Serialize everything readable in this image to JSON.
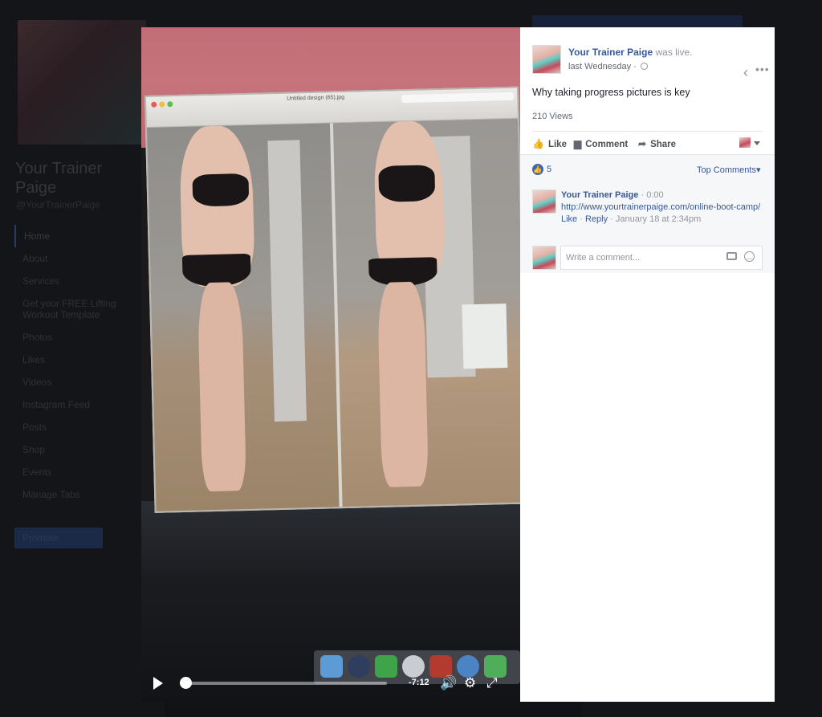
{
  "background_page": {
    "title": "Your Trainer Paige",
    "handle": "@YourTrainerPaige",
    "nav": [
      "Home",
      "About",
      "Services",
      "Get your FREE Lifting Workout Template",
      "Photos",
      "Likes",
      "Videos",
      "Instagram Feed",
      "Posts",
      "Shop",
      "Events",
      "Manage Tabs"
    ],
    "promote_label": "Promote"
  },
  "video": {
    "screen_title": "Untitled design (65).jpg",
    "time_remaining": "-7:12",
    "progress": 0.02,
    "play_label": "▶",
    "volume_icon": "🔊",
    "settings_icon": "⚙",
    "fullscreen_icon": "⤢"
  },
  "post": {
    "author": "Your Trainer Paige",
    "status": "was live.",
    "timestamp": "last Wednesday",
    "text": "Why taking progress pictures is key",
    "views": "210 Views",
    "actions": {
      "like": "Like",
      "comment": "Comment",
      "share": "Share"
    }
  },
  "comments": {
    "reaction_count": "5",
    "sort_label": "Top Comments",
    "items": [
      {
        "author": "Your Trainer Paige",
        "time_marker": "0:00",
        "link": "http://www.yourtrainerpaige.com/online-boot-camp/",
        "like": "Like",
        "reply": "Reply",
        "date": "January 18 at 2:34pm"
      }
    ],
    "compose_placeholder": "Write a comment..."
  }
}
